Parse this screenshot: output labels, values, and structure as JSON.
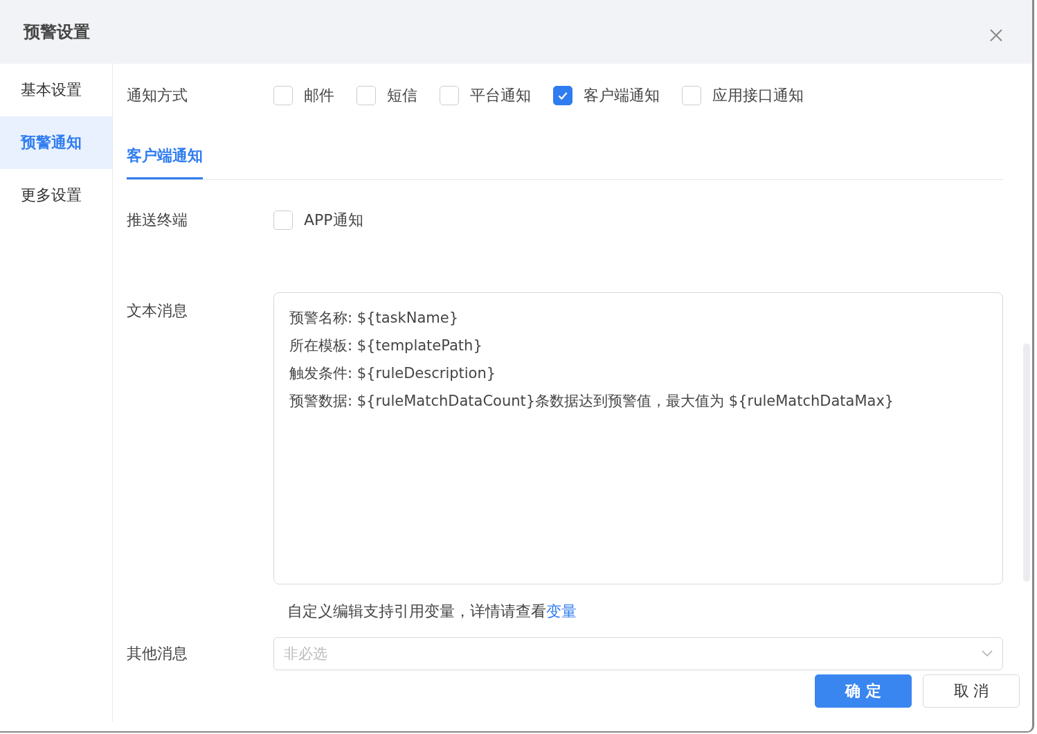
{
  "dialog": {
    "title": "预警设置"
  },
  "sidebar": {
    "items": [
      {
        "label": "基本设置",
        "selected": false
      },
      {
        "label": "预警通知",
        "selected": true
      },
      {
        "label": "更多设置",
        "selected": false
      }
    ]
  },
  "notify_method": {
    "label": "通知方式",
    "options": [
      {
        "label": "邮件",
        "checked": false
      },
      {
        "label": "短信",
        "checked": false
      },
      {
        "label": "平台通知",
        "checked": false
      },
      {
        "label": "客户端通知",
        "checked": true
      },
      {
        "label": "应用接口通知",
        "checked": false
      }
    ]
  },
  "tabs": [
    {
      "label": "客户端通知",
      "selected": true
    }
  ],
  "push_terminal": {
    "label": "推送终端",
    "options": [
      {
        "label": "APP通知",
        "checked": false
      }
    ]
  },
  "text_message": {
    "label": "文本消息",
    "value": "预警名称: ${taskName}\n所在模板: ${templatePath}\n触发条件: ${ruleDescription}\n预警数据: ${ruleMatchDataCount}条数据达到预警值，最大值为 ${ruleMatchDataMax}",
    "hint": "自定义编辑支持引用变量，详情请查看",
    "hint_link": "变量"
  },
  "other_message": {
    "label": "其他消息",
    "placeholder": "非必选"
  },
  "buttons": [
    {
      "label": "确 定",
      "kind": "primary"
    },
    {
      "label": "取 消",
      "kind": "default"
    }
  ]
}
